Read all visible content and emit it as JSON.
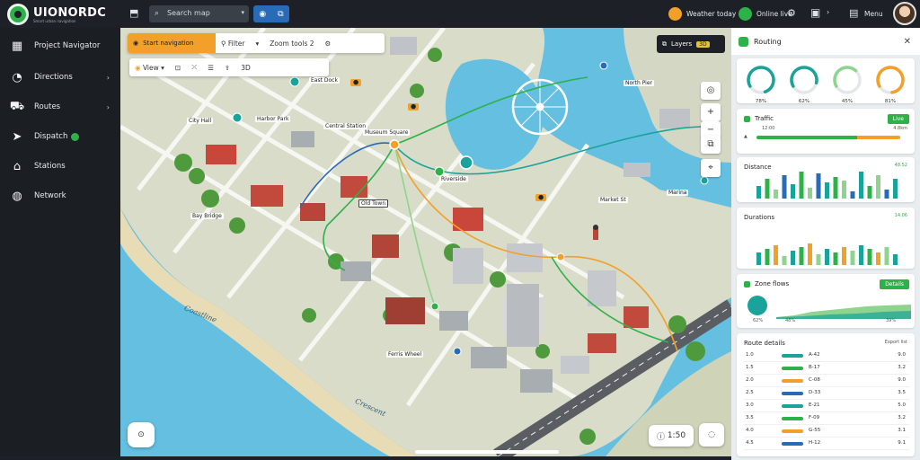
{
  "app": {
    "title": "UIONORDC",
    "subtitle": "Smart urban navigation"
  },
  "topbar": {
    "search_text": "Search map",
    "toggle_icons": [
      "map-icon",
      "layers-icon"
    ],
    "weather_label": "Weather today",
    "status_label": "Online live",
    "menu_label": "Menu",
    "colors": {
      "accent": "#2fb14a",
      "toggle": "#2a6bb8",
      "warning": "#f2a02a"
    }
  },
  "sidebar": {
    "items": [
      {
        "label": "Project Navigator",
        "icon": "grid-icon",
        "chevron": false,
        "badge": false
      },
      {
        "label": "Directions",
        "icon": "compass-icon",
        "chevron": true,
        "badge": false
      },
      {
        "label": "Routes",
        "icon": "route-icon",
        "chevron": true,
        "badge": false
      },
      {
        "label": "Dispatch",
        "icon": "send-icon",
        "chevron": false,
        "badge": true
      },
      {
        "label": "Stations",
        "icon": "station-icon",
        "chevron": false,
        "badge": false
      },
      {
        "label": "Network",
        "icon": "globe-icon",
        "chevron": false,
        "badge": false
      }
    ]
  },
  "map": {
    "toolbar1": {
      "primary": "Start navigation",
      "filter": "Filter",
      "zoom": "Zoom tools",
      "count": "2"
    },
    "toolbar2": {
      "view": "View",
      "mode": "3D"
    },
    "layer_badge": {
      "label": "Layers",
      "value": "3D"
    },
    "water_labels": [
      "Coastline",
      "Crescent"
    ],
    "labels": [
      "City Hall",
      "Harbor Park",
      "Central Station",
      "Museum Square",
      "Old Town",
      "Riverside",
      "Market St",
      "Bay Bridge",
      "Ferris Wheel",
      "North Pier",
      "Marina",
      "East Dock"
    ],
    "scale_text": "1:50"
  },
  "rpanel": {
    "title": "Routing",
    "gauges": [
      {
        "value": "78%",
        "color": "#1aa39a",
        "fill": 0.78
      },
      {
        "value": "62%",
        "color": "#1aa39a",
        "fill": 0.62
      },
      {
        "value": "45%",
        "color": "#8fd48e",
        "fill": 0.45
      },
      {
        "value": "81%",
        "color": "#f2a02a",
        "fill": 0.81
      }
    ],
    "traffic": {
      "title": "Traffic",
      "button": "Live",
      "value_a": "12:00",
      "value_b": "4.8km"
    },
    "distance": {
      "title": "Distance",
      "total": "48.52"
    },
    "durations": {
      "title": "Durations",
      "total": "14.06"
    },
    "zones": {
      "title": "Zone flows",
      "button": "Details",
      "values": [
        "62%",
        "48%",
        "39%"
      ]
    },
    "table": {
      "title": "Route details",
      "right": "Export list",
      "rows": [
        {
          "id": "1.0",
          "tag": "A-42",
          "val": "9.0"
        },
        {
          "id": "1.5",
          "tag": "B-17",
          "val": "3.2"
        },
        {
          "id": "2.0",
          "tag": "C-08",
          "val": "9.0"
        },
        {
          "id": "2.5",
          "tag": "D-33",
          "val": "3.5"
        },
        {
          "id": "3.0",
          "tag": "E-21",
          "val": "5.0"
        },
        {
          "id": "3.5",
          "tag": "F-09",
          "val": "3.2"
        },
        {
          "id": "4.0",
          "tag": "G-55",
          "val": "3.1"
        },
        {
          "id": "4.5",
          "tag": "H-12",
          "val": "9.1"
        }
      ]
    }
  }
}
